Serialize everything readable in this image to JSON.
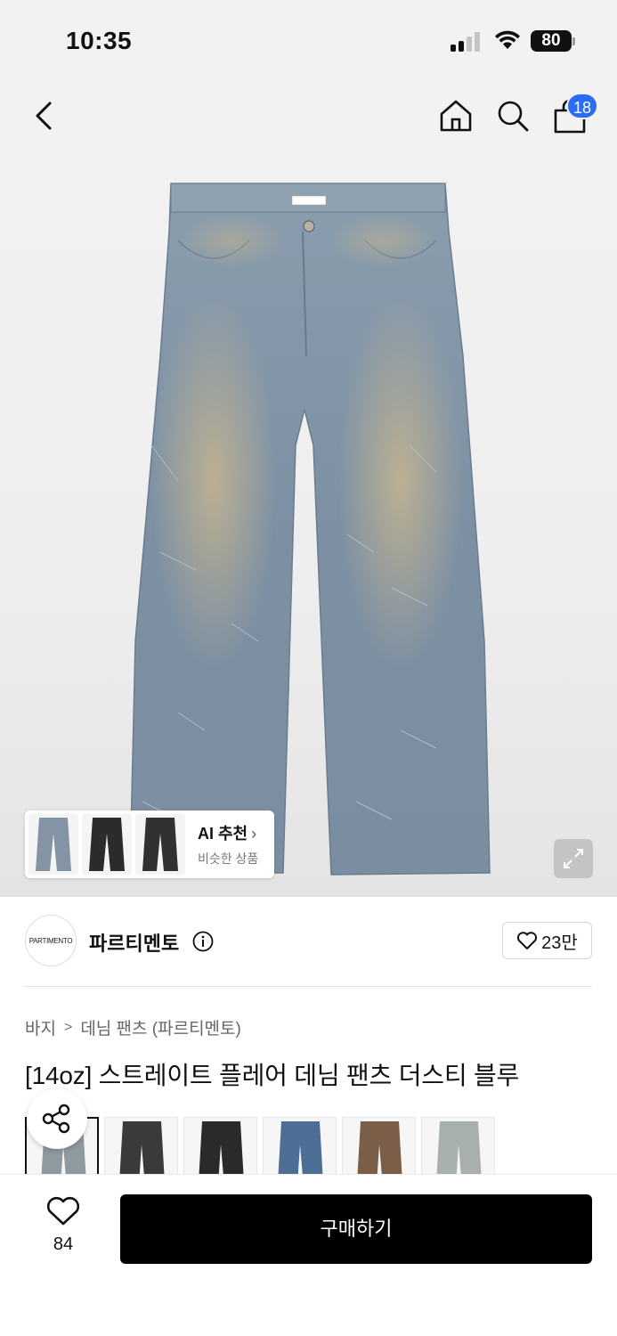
{
  "status_bar": {
    "time": "10:35",
    "battery": "80"
  },
  "nav": {
    "cart_count": "18"
  },
  "ai_recommend": {
    "title": "AI 추천",
    "chevron": "›",
    "subtitle": "비슷한 상품"
  },
  "brand": {
    "logo_text": "PARTIMENTO",
    "name": "파르티멘토",
    "likes": "23만"
  },
  "breadcrumb": {
    "category": "바지",
    "separator": ">",
    "subcategory": "데님 팬츠 (파르티멘토)"
  },
  "product": {
    "title": "[14oz] 스트레이트 플레어 데님 팬츠 더스티 블루"
  },
  "color_options": [
    {
      "name": "dusty-blue",
      "color": "#8e99a0",
      "selected": true
    },
    {
      "name": "black-wash",
      "color": "#3a3a3c"
    },
    {
      "name": "black",
      "color": "#2a2a2a"
    },
    {
      "name": "mid-blue",
      "color": "#4d6f96"
    },
    {
      "name": "brown",
      "color": "#7b5e48"
    },
    {
      "name": "light-grey",
      "color": "#a7b0ad"
    }
  ],
  "bottom_bar": {
    "wish_count": "84",
    "buy_label": "구매하기"
  },
  "colors": {
    "accent_badge": "#2a6cf5",
    "buy_button": "#000000",
    "denim": "#7f93a6"
  },
  "icons": [
    "back-icon",
    "home-icon",
    "search-icon",
    "shopping-bag-icon",
    "expand-icon",
    "info-icon",
    "heart-icon",
    "share-icon"
  ]
}
